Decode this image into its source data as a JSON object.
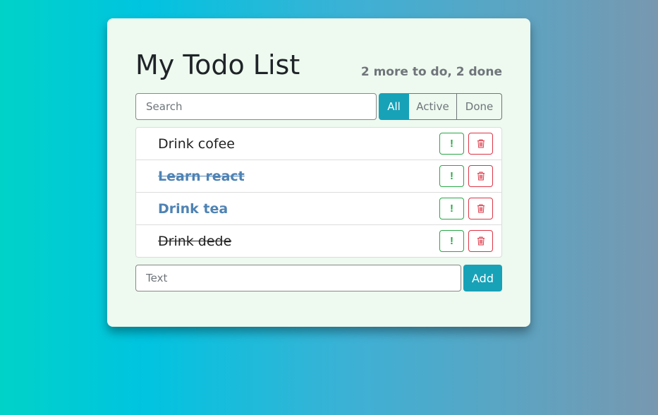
{
  "app": {
    "title": "My Todo List",
    "status_text": "2 more to do, 2 done"
  },
  "search": {
    "placeholder": "Search",
    "value": ""
  },
  "filters": [
    {
      "label": "All",
      "active": true
    },
    {
      "label": "Active",
      "active": false
    },
    {
      "label": "Done",
      "active": false
    }
  ],
  "todos": [
    {
      "label": "Drink cofee",
      "done": false,
      "important": false
    },
    {
      "label": "Learn react",
      "done": true,
      "important": true
    },
    {
      "label": "Drink tea",
      "done": false,
      "important": true
    },
    {
      "label": "Drink dede",
      "done": true,
      "important": false
    }
  ],
  "item_buttons": {
    "important_icon": "exclamation-icon",
    "important_glyph": "!",
    "delete_icon": "trash-icon"
  },
  "add_form": {
    "placeholder": "Text",
    "value": "",
    "button_label": "Add"
  },
  "colors": {
    "accent": "#17a2b8",
    "important": "#4f83b4",
    "success": "#28a745",
    "danger": "#dc3545",
    "card_bg": "#eef9ef"
  }
}
